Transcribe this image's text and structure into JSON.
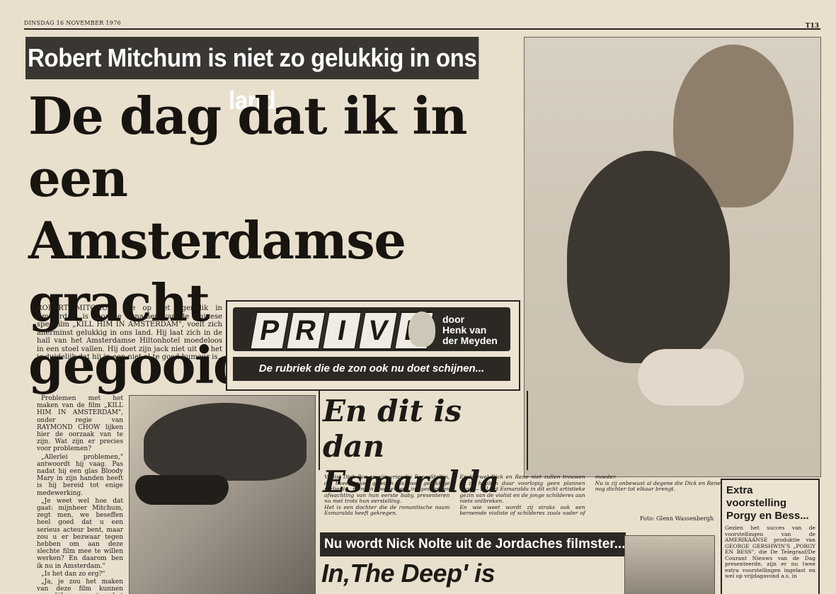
{
  "header": {
    "running_head": "DINSDAG 16 NOVEMBER 1976",
    "page_number": "T13"
  },
  "kicker": "Robert Mitchum is niet zo gelukkig in ons land",
  "headline": {
    "line1": "De dag dat ik in een",
    "line2": "Amsterdamse gracht",
    "line3": "gegooid werd...."
  },
  "lead": "ROBERT MITCHUM, die op het ogenblik in Amsterdam is voor de opnamen van de Chinese speelfilm „KILL HIM IN AMSTERDAM\", voelt zich allerminst gelukkig in ons land. Hij laat zich in de hall van het Amsterdamse Hiltonhotel moedeloos in een stoel vallen. Hij doet zijn jack niet uit en het is duidelijk dat hij in een niet al te goed humeur is.",
  "body_col1": [
    "Problemen met het maken van de film „KILL HIM IN AMSTERDAM\", onder regie van RAYMOND CHOW lijken hier de oorzaak van te zijn. Wat zijn er precies voor problemen?",
    "„Allerlei problemen,\" antwoordt hij vaag. Pas nadat hij een glas Bloody Mary in zijn handen heeft is hij bereid tot enige medewerking.",
    "„Je weet wel hoe dat gaat: mijnheer Mitchum, zegt men, we beseffen heel goed dat u een serieus acteur bent, maar zou u er bezwaar tegen hebben om aan deze slechte film mee te willen werken? En daarom ben ik nu in Amsterdam.\"",
    "„Is het dan zo erg?\"",
    "„Ja, je zou het maken van deze film kunnen vergelijken met het meedoen aan een motorrace, waarbij je"
  ],
  "prive": {
    "letters": [
      "P",
      "R",
      "I",
      "V",
      "E"
    ],
    "byline1": "door",
    "byline2": "Henk van",
    "byline3": "der Meyden",
    "subtitle": "De rubriek die de zon ook nu doet schijnen..."
  },
  "esmaralda": {
    "title_line1": "En dit is dan",
    "title_line2": "Esmaralda",
    "paragraphs": [
      "Violist Dick Bor en zijn vriendin Rene Stoltjn, die twee weken geleden als twee gelukkige verliefde mensen poseerden in gespannen afwachting van hun eerste baby, presenteren nu met trots hun eerstelling.",
      "Het is een dochter die de romantische naam Esmaralda heeft gekregen.",
      "En hoewel Dick en Rene niet zullen trouwen — zij hebben daar voorlopig geen plannen voor — zal het Esmaralda in dit echt artistieke gezin van de violist en de jonge schilderes aan niets ontbreken.",
      "En wie weet wordt zij straks ook een beroemde violiste of schilderes zoals vader of moeder.",
      "Nu is zij onbewust al degene die Dick en Rene nog dichter tot elkaar brengt."
    ],
    "photo_credit": "Foto: Glenn Wassenbergh"
  },
  "extra": {
    "title": "Extra voorstelling Porgy en Bess...",
    "text": "Gezien het succes van de voorstellingen van de AMERIKAANSE produktie van GEORGE GERSHWIN'S „PORGY EN BESS\", die De Telegraaf/De Courant Nieuws van de Dag presenteerde, zijn er nu twee extra voorstellingen ingelast en wel op vrijdagavond a.s. in"
  },
  "nolte": {
    "kicker": "Nu wordt Nick Nolte uit de Jordaches filmster...",
    "title": "In‚The Deep' is Jacqueline"
  }
}
